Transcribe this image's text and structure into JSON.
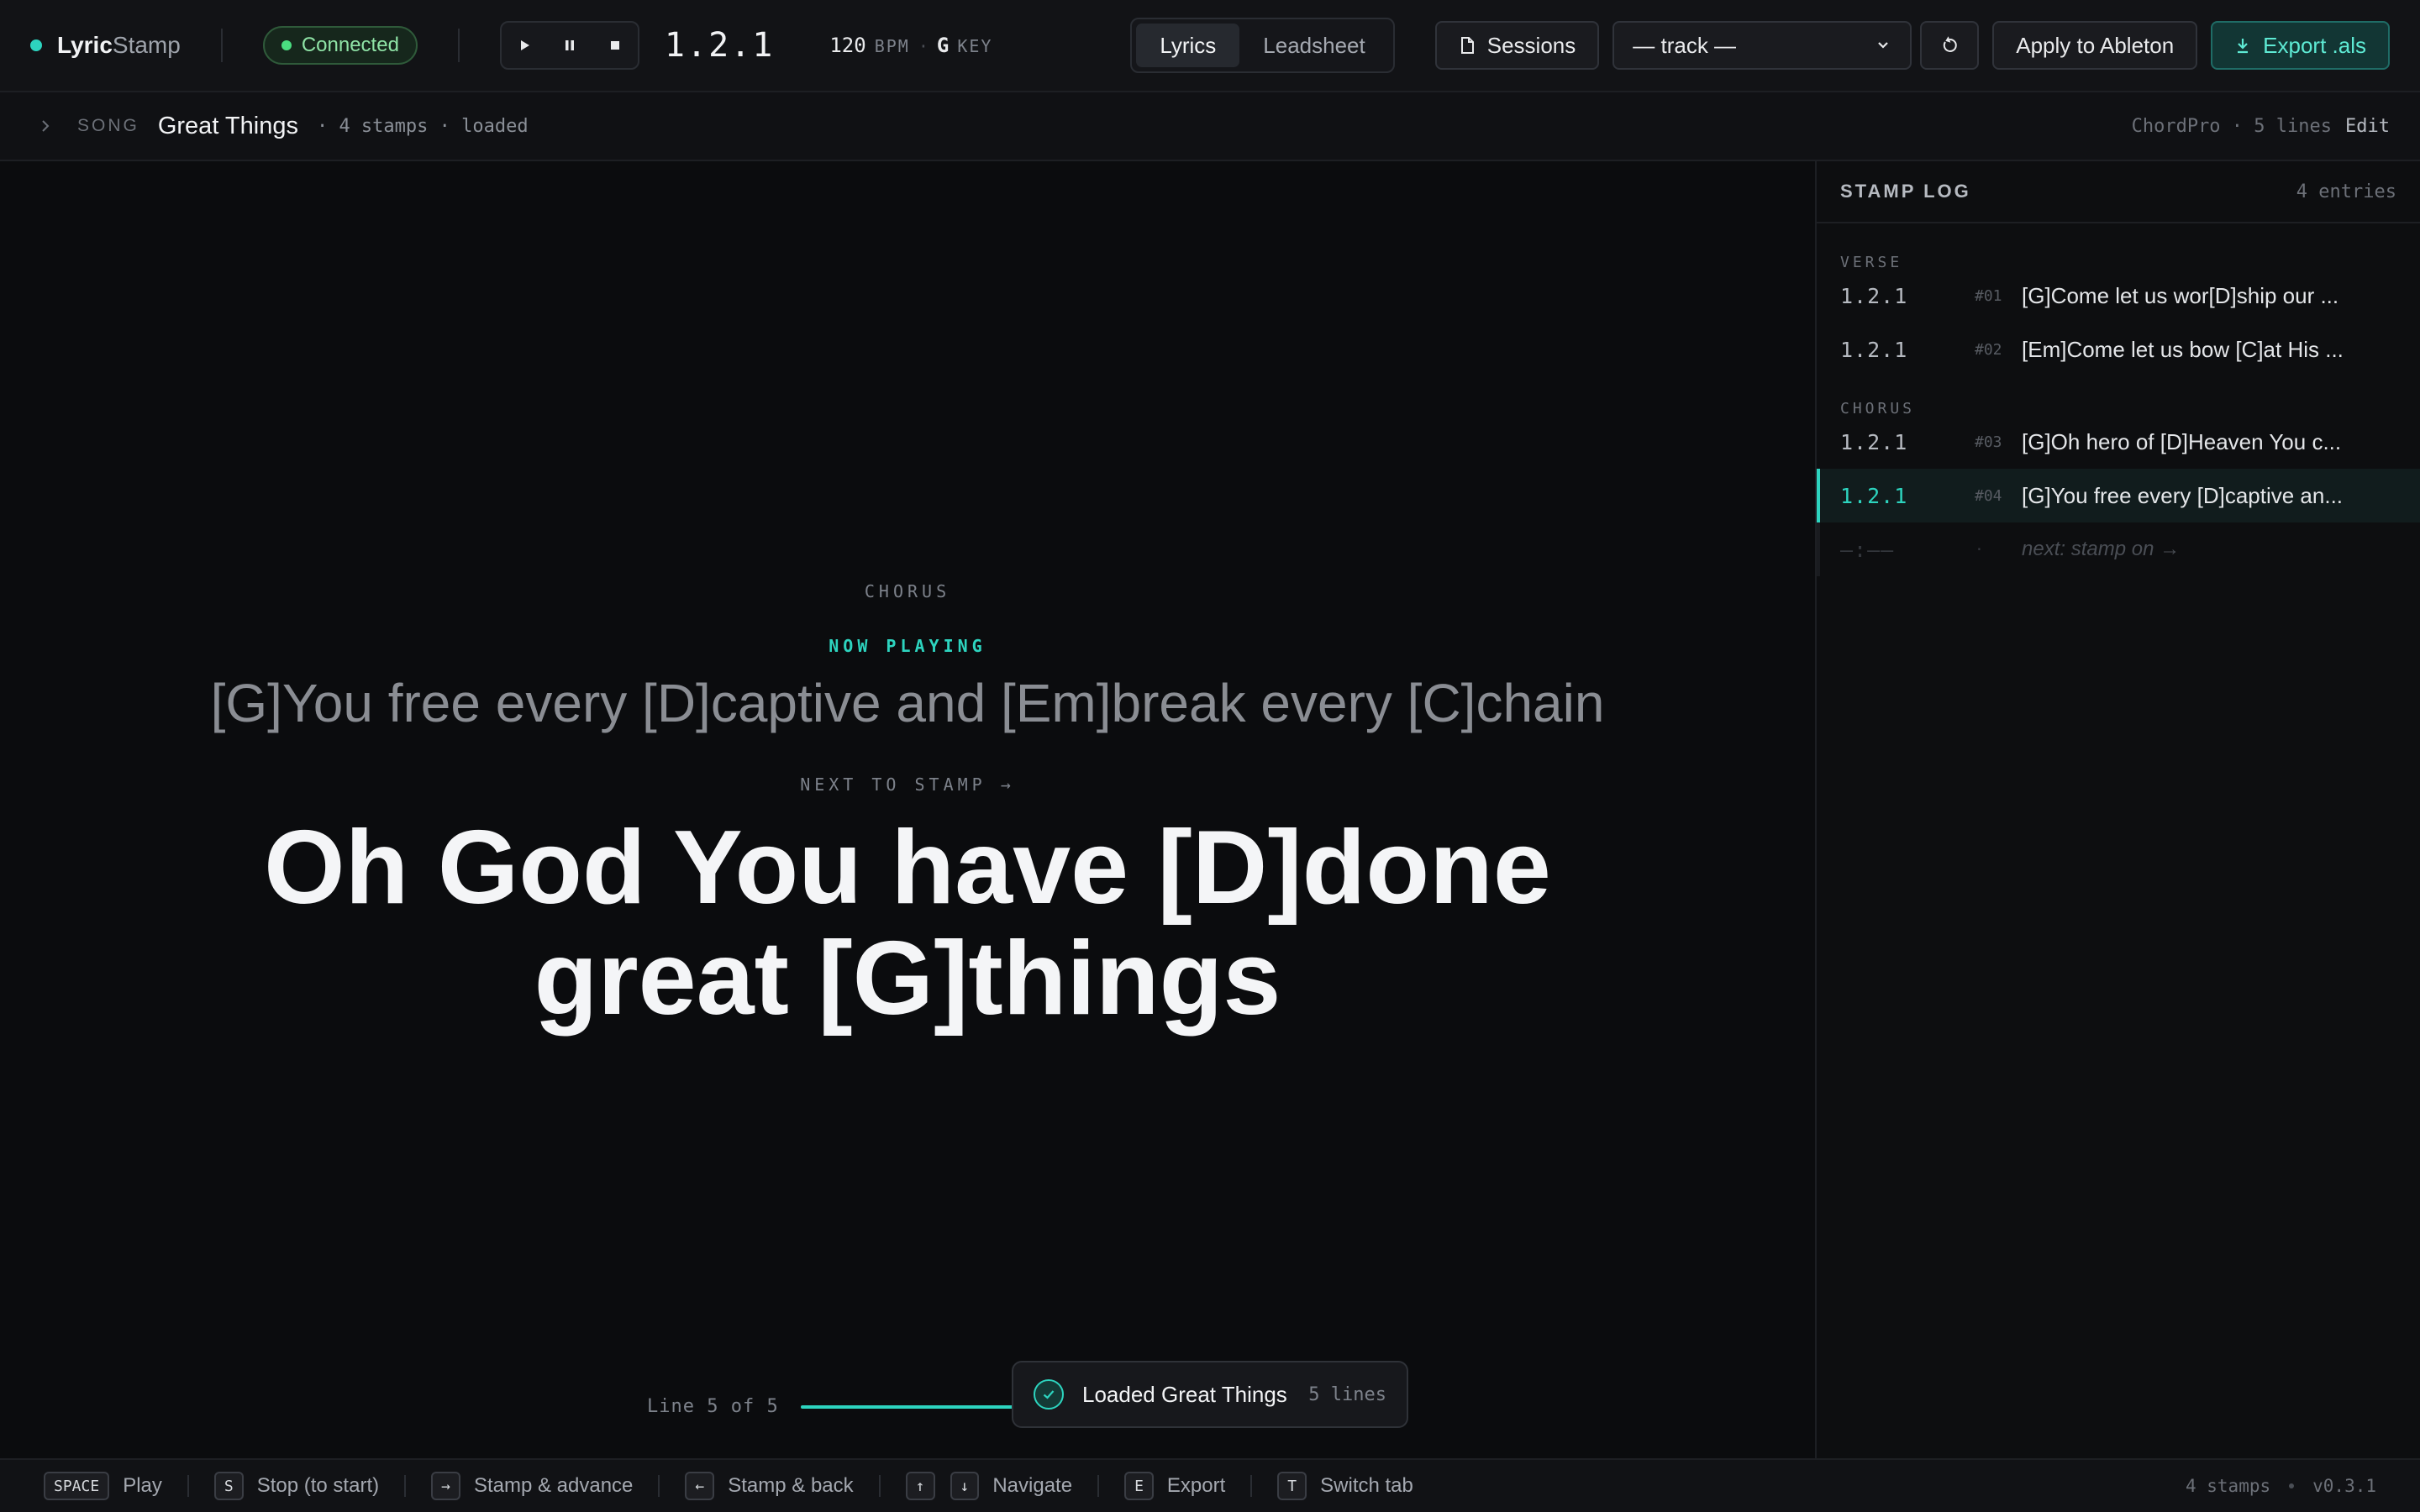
{
  "app": {
    "name_bold": "Lyric",
    "name_rest": "Stamp",
    "status": "Connected"
  },
  "transport": {
    "position": "1.2.1",
    "bpm": "120",
    "bpm_unit": "BPM",
    "key": "G",
    "key_unit": "KEY",
    "sep": "·"
  },
  "tabs": [
    {
      "label": "Lyrics",
      "active": true
    },
    {
      "label": "Leadsheet",
      "active": false
    }
  ],
  "toolbar": {
    "sessions": "Sessions",
    "track_select": "— track —",
    "apply": "Apply to Ableton",
    "export": "Export .als"
  },
  "song": {
    "tag": "SONG",
    "title": "Great Things",
    "meta": "· 4 stamps · loaded",
    "format": "ChordPro · 5 lines",
    "edit": "Edit"
  },
  "display": {
    "section": "CHORUS",
    "now_label": "NOW PLAYING",
    "now_line": "[G]You free every [D]captive and [Em]break every [C]chain",
    "next_label": "NEXT TO STAMP →",
    "next_line": "Oh God You have [D]done great [G]things",
    "progress_label": "Line 5 of 5",
    "progress_fraction": 0.8
  },
  "toast": {
    "text": "Loaded Great Things",
    "count": "5 lines"
  },
  "stamp_log": {
    "title": "STAMP LOG",
    "count": "4 entries",
    "groups": [
      {
        "label": "VERSE",
        "rows": [
          {
            "pos": "1.2.1",
            "num": "#01",
            "text": "[G]Come let us wor[D]ship our ..."
          },
          {
            "pos": "1.2.1",
            "num": "#02",
            "text": "[Em]Come let us bow [C]at His ..."
          }
        ]
      },
      {
        "label": "CHORUS",
        "rows": [
          {
            "pos": "1.2.1",
            "num": "#03",
            "text": "[G]Oh hero of [D]Heaven You c..."
          },
          {
            "pos": "1.2.1",
            "num": "#04",
            "text": "[G]You free every [D]captive an..."
          }
        ]
      }
    ],
    "next_row": {
      "pos": "—:——",
      "num": "·",
      "text": "next: stamp on →"
    }
  },
  "shortcuts": [
    {
      "keys": [
        "SPACE"
      ],
      "label": "Play"
    },
    {
      "keys": [
        "S"
      ],
      "label": "Stop (to start)"
    },
    {
      "keys": [
        "→"
      ],
      "label": "Stamp & advance"
    },
    {
      "keys": [
        "←"
      ],
      "label": "Stamp & back"
    },
    {
      "keys": [
        "↑",
        "↓"
      ],
      "label": "Navigate"
    },
    {
      "keys": [
        "E"
      ],
      "label": "Export"
    },
    {
      "keys": [
        "T"
      ],
      "label": "Switch tab"
    }
  ],
  "footer": {
    "stamps": "4 stamps",
    "version": "v0.3.1"
  },
  "colors": {
    "accent": "#2dd4bf",
    "connected": "#4ade80",
    "background": "#0b0c0e"
  }
}
